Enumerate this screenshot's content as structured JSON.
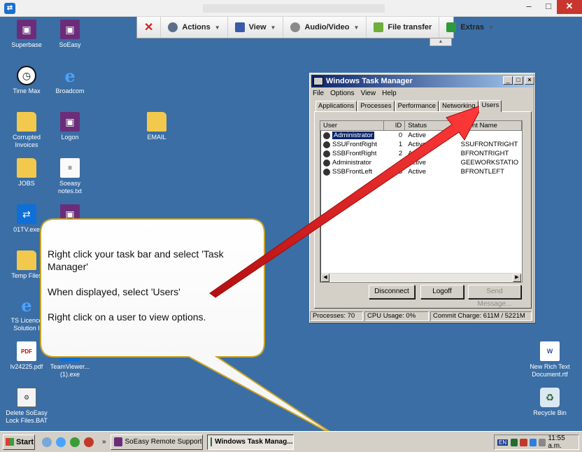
{
  "outer_window": {
    "app_icon": "teamviewer-icon",
    "min_glyph": "–",
    "max_glyph": "□",
    "close_glyph": "✕"
  },
  "tv_toolbar": {
    "close_glyph": "✕",
    "items": [
      {
        "label": "Actions",
        "icon": "gear-icon",
        "color": "#5b6f8a"
      },
      {
        "label": "View",
        "icon": "monitor-icon",
        "color": "#3b5aa8"
      },
      {
        "label": "Audio/Video",
        "icon": "speaker-icon",
        "color": "#8a8a8a"
      },
      {
        "label": "File transfer",
        "icon": "file-transfer-icon",
        "color": "#6fae3a"
      },
      {
        "label": "Extras",
        "icon": "extras-icon",
        "color": "#2f9a3a"
      }
    ],
    "caret": "▼",
    "handle_glyph": "▲"
  },
  "desktop_icons": [
    {
      "label": "Superbase",
      "icon": "superbase-icon"
    },
    {
      "label": "SoEasy",
      "icon": "soeasy-icon"
    },
    {
      "label": "Time Max",
      "icon": "clock-icon"
    },
    {
      "label": "Broadcom",
      "icon": "ie-shortcut-icon"
    },
    {
      "label": "Corrupted Invoices",
      "icon": "folder-icon"
    },
    {
      "label": "Logon",
      "icon": "logon-icon"
    },
    {
      "label": "EMAIL",
      "icon": "folder-icon"
    },
    {
      "label": "JOBS",
      "icon": "folder-icon"
    },
    {
      "label": "Soeasy notes.txt",
      "icon": "text-file-icon"
    },
    {
      "label": "01TV.exe",
      "icon": "teamviewer-icon"
    },
    {
      "label": "Temp Files",
      "icon": "folder-icon"
    },
    {
      "label": "TS Licence Solution I",
      "icon": "ie-shortcut-icon"
    },
    {
      "label": "lv24225.pdf",
      "icon": "pdf-icon"
    },
    {
      "label": "TeamViewer... (1).exe",
      "icon": "teamviewer-installer-icon"
    },
    {
      "label": "Delete SoEasy Lock Files.BAT",
      "icon": "batch-file-icon"
    },
    {
      "label": "New Rich Text Document.rtf",
      "icon": "rtf-file-icon"
    },
    {
      "label": "Recycle Bin",
      "icon": "recycle-bin-icon"
    }
  ],
  "task_manager": {
    "title": "Windows Task Manager",
    "menu": [
      "File",
      "Options",
      "View",
      "Help"
    ],
    "tabs": [
      "Applications",
      "Processes",
      "Performance",
      "Networking",
      "Users"
    ],
    "active_tab": "Users",
    "columns": [
      "User",
      "ID",
      "Status",
      "Client Name"
    ],
    "rows": [
      {
        "user": "Administrator",
        "id": "0",
        "status": "Active",
        "client": ""
      },
      {
        "user": "SSUFrontRight",
        "id": "1",
        "status": "Active",
        "client": "SSUFRONTRIGHT"
      },
      {
        "user": "SSBFrontRight",
        "id": "2",
        "status": "Active",
        "client": "BFRONTRIGHT"
      },
      {
        "user": "Administrator",
        "id": "4",
        "status": "Active",
        "client": "GEEWORKSTATIO"
      },
      {
        "user": "SSBFrontLeft",
        "id": "3",
        "status": "Active",
        "client": "BFRONTLEFT"
      }
    ],
    "selected_row": 0,
    "buttons": {
      "disconnect": "Disconnect",
      "logoff": "Logoff",
      "send": "Send Message..."
    },
    "status": {
      "processes": "Processes: 70",
      "cpu": "CPU Usage: 0%",
      "commit": "Commit Charge: 611M / 5221M"
    }
  },
  "callout": {
    "line1": "Right click your task bar and select 'Task Manager'",
    "line2": "When displayed, select 'Users'",
    "line3": "Right click on a user to view options.",
    "arrow_color": "#e41e1e",
    "bubble_border": "#c9a227"
  },
  "taskbar": {
    "start": "Start",
    "tasks": [
      {
        "label": "SoEasy Remote Support",
        "icon": "soeasy-icon"
      },
      {
        "label": "Windows Task Manag...",
        "icon": "task-manager-icon"
      }
    ],
    "tray_lang": "EN",
    "clock": "11:55 a.m."
  }
}
